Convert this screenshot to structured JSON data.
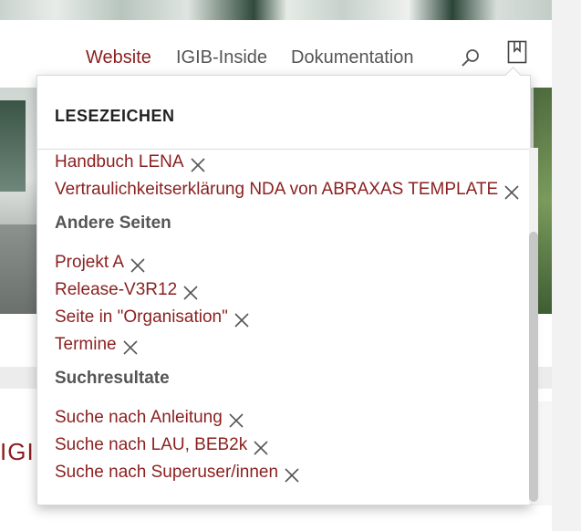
{
  "nav": {
    "items": [
      {
        "label": "Website",
        "active": true
      },
      {
        "label": "IGIB-Inside",
        "active": false
      },
      {
        "label": "Dokumentation",
        "active": false
      }
    ],
    "icons": {
      "search": "search-icon",
      "bookmark": "bookmark-icon"
    }
  },
  "background": {
    "heading_fragment": "IGI"
  },
  "bookmarks": {
    "title": "LESEZEICHEN",
    "top_items": [
      {
        "label": "Handbuch LENA"
      },
      {
        "label": "Vertraulichkeitserklärung NDA von ABRAXAS TEMPLATE"
      }
    ],
    "groups": [
      {
        "title": "Andere Seiten",
        "items": [
          {
            "label": "Projekt A"
          },
          {
            "label": "Release-V3R12"
          },
          {
            "label": "Seite in \"Organisation\""
          },
          {
            "label": "Termine"
          }
        ]
      },
      {
        "title": "Suchresultate",
        "items": [
          {
            "label": "Suche nach Anleitung"
          },
          {
            "label": "Suche nach LAU, BEB2k"
          },
          {
            "label": "Suche nach Superuser/innen"
          }
        ]
      }
    ],
    "remove_icon": "close-icon"
  },
  "colors": {
    "accent": "#8b1f1f",
    "text": "#555555",
    "heading": "#222222"
  }
}
